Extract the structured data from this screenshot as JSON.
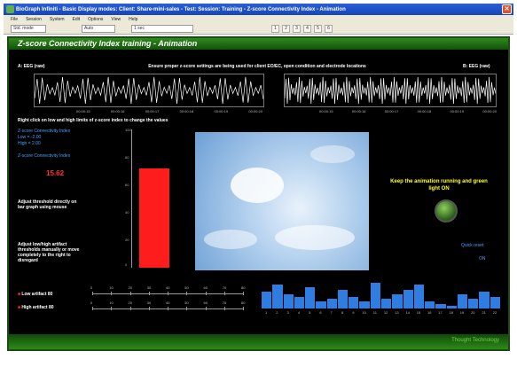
{
  "window": {
    "title": "BioGraph Infiniti - Basic Display modes: Client: Share-mini-sales - Test: Session: Training - Z-score Connectivity Index - Animation"
  },
  "menubar": {
    "items": [
      "File",
      "Session",
      "System",
      "Edit",
      "Options",
      "View",
      "Help"
    ]
  },
  "toolbar": {
    "mode_field": "Std. mode",
    "scale_field": "Auto",
    "time_field": "1 sec",
    "buttons": [
      "1",
      "2",
      "3",
      "4",
      "5",
      "6"
    ]
  },
  "app": {
    "title": "Z-score Connectivity Index training - Animation",
    "instruction": "Ensure proper z-score settings are being used for client EO/EC, open condition and electrode locations",
    "left_channel": "A: EEG (raw)",
    "right_channel": "B: EEG (raw)",
    "left_times": [
      "00:00:15",
      "00:00:16",
      "00:00:17",
      "00:00:18",
      "00:00:19",
      "00:00:20"
    ],
    "right_times": [
      "00:00:15",
      "00:00:16",
      "00:00:17",
      "00:00:18",
      "00:00:19",
      "00:00:20"
    ],
    "right_click_hint": "Right click on low and high limits of z-score index to change the values",
    "zscore_label": "Z-score Connectivity Index",
    "low_label": "Low = -2.00",
    "high_label": "High = 2.00",
    "zscore_index_label": "Z-score Connectivity Index",
    "zscore_value": "15.62",
    "threshold_hint": "Adjust threshold directly on bar graph using mouse",
    "artifact_hint": "Adjust low/high artifact thresholds manually or move completely to the right to disregard",
    "low_artifact": "Low artifact 80",
    "high_artifact": "High artifact 80",
    "keep_running": "Keep the animation running and green light ON",
    "quick_reset": "Quick reset",
    "on_label": "ON",
    "brand": "Thought Technology"
  },
  "gauge": {
    "ticks": [
      "100",
      "80",
      "60",
      "40",
      "20",
      "0"
    ],
    "max": 100,
    "value": 72
  },
  "artifact_scale": {
    "ticks": [
      "0",
      "10",
      "20",
      "30",
      "40",
      "50",
      "60",
      "70",
      "80"
    ]
  },
  "histogram": {
    "labels": [
      "1",
      "2",
      "3",
      "4",
      "5",
      "6",
      "7",
      "8",
      "9",
      "10",
      "11",
      "12",
      "13",
      "14",
      "15",
      "16",
      "17",
      "18",
      "19",
      "20",
      "21",
      "22"
    ],
    "values": [
      0.35,
      0.5,
      0.3,
      0.25,
      0.45,
      0.15,
      0.2,
      0.4,
      0.25,
      0.15,
      0.55,
      0.2,
      0.3,
      0.4,
      0.5,
      0.15,
      0.1,
      0.05,
      0.3,
      0.2,
      0.35,
      0.25
    ]
  },
  "colors": {
    "accent": "#2f8b1c",
    "gauge_fill": "#ff1c1c",
    "histogram": "#2f7de0",
    "text_cyan": "#3ea5ff",
    "text_yellow": "#ffff33"
  }
}
